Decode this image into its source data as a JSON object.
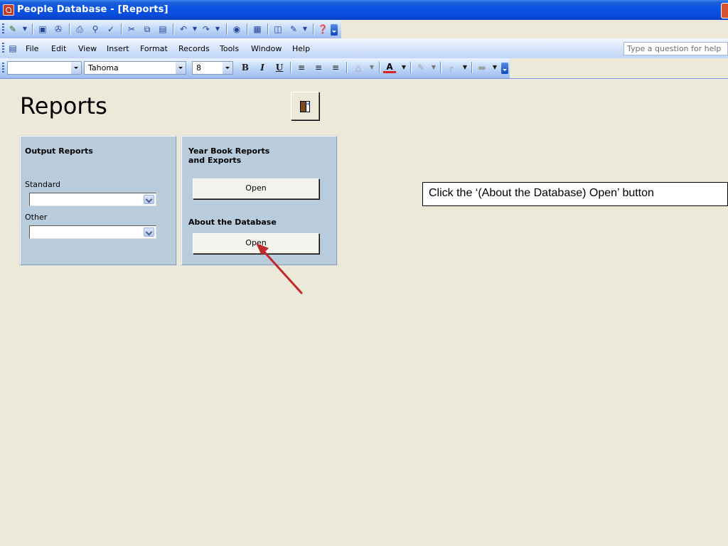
{
  "window": {
    "title": "People Database - [Reports]"
  },
  "menu": {
    "items": [
      "File",
      "Edit",
      "View",
      "Insert",
      "Format",
      "Records",
      "Tools",
      "Window",
      "Help"
    ],
    "help_placeholder": "Type a question for help"
  },
  "format_toolbar": {
    "object_combo_value": "",
    "font_name": "Tahoma",
    "font_size": "8",
    "bold_glyph": "B",
    "italic_glyph": "I",
    "underline_glyph": "U",
    "font_color_glyph": "A"
  },
  "form": {
    "title": "Reports",
    "output_panel": {
      "heading": "Output Reports",
      "standard_label": "Standard",
      "standard_value": "",
      "other_label": "Other",
      "other_value": ""
    },
    "right_panel": {
      "yearbook_heading": "Year  Book Reports\nand Exports",
      "yearbook_button": "Open",
      "about_heading": "About the Database",
      "about_button": "Open"
    }
  },
  "annotation": {
    "callout_text": "Click the ‘(About the Database) Open’ button",
    "arrow_color": "#c0282a"
  },
  "colors": {
    "title_bar": "#0a54e3",
    "panel": "#b8ccdc",
    "background": "#ece9d8"
  }
}
